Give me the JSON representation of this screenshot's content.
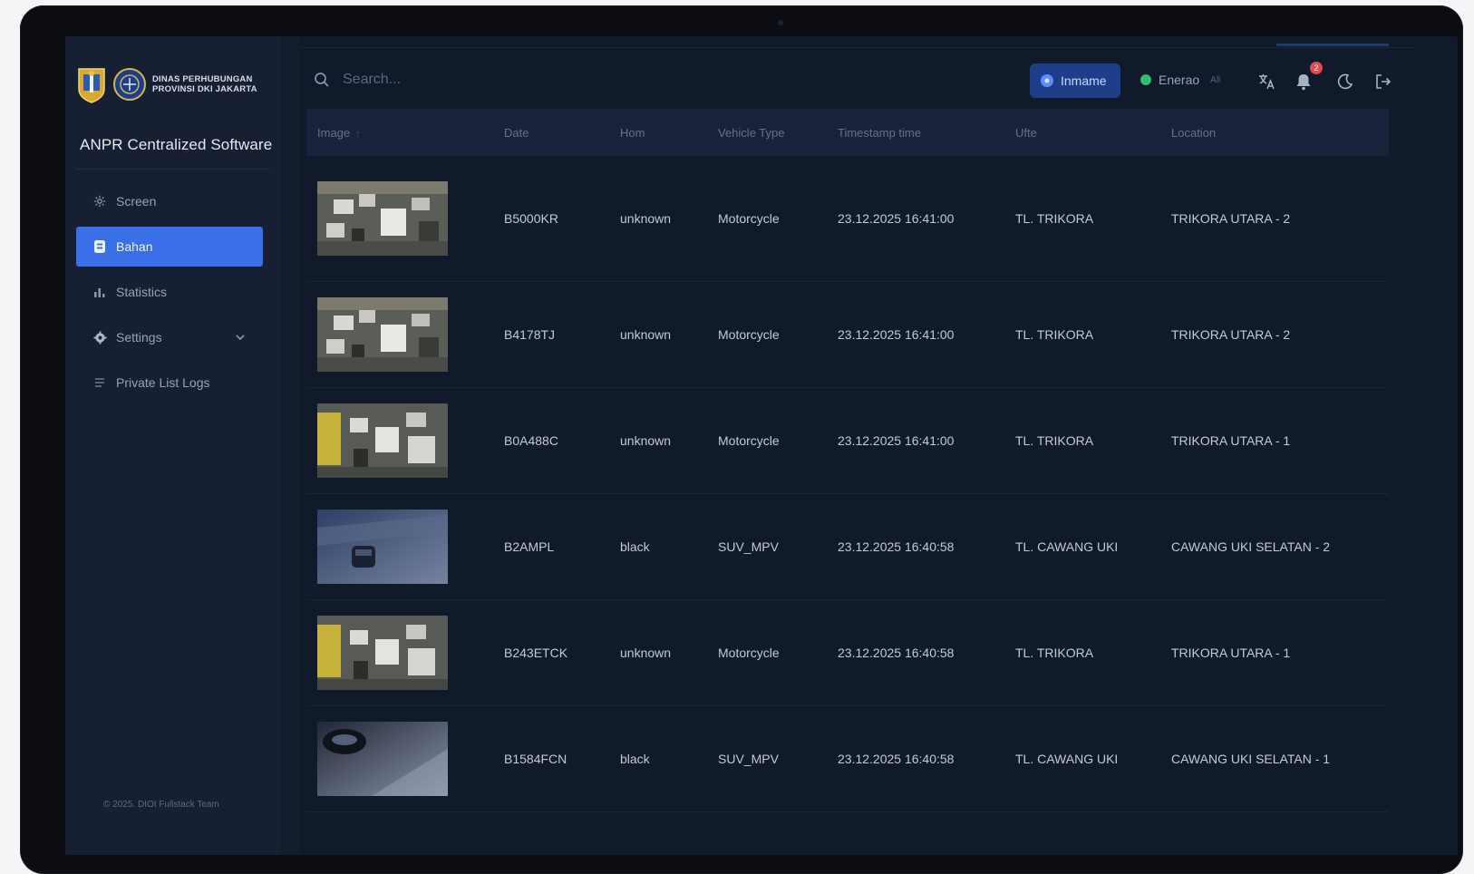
{
  "brand": {
    "logo_line1": "DINAS PERHUBUNGAN",
    "logo_line2": "PROVINSI DKI JAKARTA",
    "app_title": "ANPR Centralized Software"
  },
  "sidebar": {
    "items": [
      {
        "label": "Screen",
        "icon": "grid-icon",
        "active": false
      },
      {
        "label": "Bahan",
        "icon": "document-icon",
        "active": true
      },
      {
        "label": "Statistics",
        "icon": "bar-chart-icon",
        "active": false
      },
      {
        "label": "Settings",
        "icon": "gear-icon",
        "active": false,
        "expandable": true
      },
      {
        "label": "Private List Logs",
        "icon": "list-icon",
        "active": false
      }
    ],
    "footer": "© 2025. DIOI Fullstack Team"
  },
  "topbar": {
    "search_placeholder": "Search...",
    "user_label": "Inmame",
    "status_label": "Enerao",
    "status_extra": "All",
    "notification_count": "2"
  },
  "table": {
    "headers": [
      "Image",
      "Date",
      "Hom",
      "Vehicle Type",
      "Timestamp time",
      "Ufte",
      "Location"
    ],
    "sort_indicator": "↑",
    "rows": [
      {
        "plate": "B5000KR",
        "color": "unknown",
        "type": "Motorcycle",
        "time": "23.12.2025 16:41:00",
        "site": "TL. TRIKORA",
        "location": "TRIKORA UTARA - 2",
        "thumb": "traffic-day"
      },
      {
        "plate": "B4178TJ",
        "color": "unknown",
        "type": "Motorcycle",
        "time": "23.12.2025 16:41:00",
        "site": "TL. TRIKORA",
        "location": "TRIKORA UTARA - 2",
        "thumb": "traffic-day"
      },
      {
        "plate": "B0A488C",
        "color": "unknown",
        "type": "Motorcycle",
        "time": "23.12.2025 16:41:00",
        "site": "TL. TRIKORA",
        "location": "TRIKORA UTARA - 1",
        "thumb": "traffic-bus"
      },
      {
        "plate": "B2AMPL",
        "color": "black",
        "type": "SUV_MPV",
        "time": "23.12.2025 16:40:58",
        "site": "TL. CAWANG UKI",
        "location": "CAWANG UKI SELATAN - 2",
        "thumb": "night-car"
      },
      {
        "plate": "B243ETCK",
        "color": "unknown",
        "type": "Motorcycle",
        "time": "23.12.2025 16:40:58",
        "site": "TL. TRIKORA",
        "location": "TRIKORA UTARA - 1",
        "thumb": "traffic-bus"
      },
      {
        "plate": "B1584FCN",
        "color": "black",
        "type": "SUV_MPV",
        "time": "23.12.2025 16:40:58",
        "site": "TL. CAWANG UKI",
        "location": "CAWANG UKI SELATAN - 1",
        "thumb": "night-car2"
      }
    ]
  },
  "colors": {
    "accent": "#3b6fea",
    "background": "#111a2b",
    "sidebar": "#172033",
    "status_online": "#2fbf6a",
    "badge": "#e5484d"
  }
}
